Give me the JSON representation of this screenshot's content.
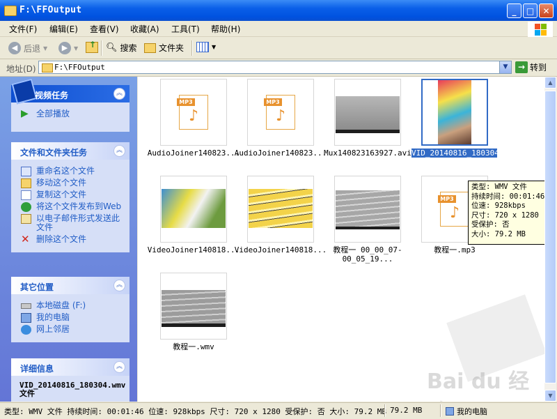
{
  "window": {
    "title": "F:\\FFOutput",
    "minimize": "_",
    "maximize": "□",
    "close": "✕"
  },
  "menu": [
    "文件(F)",
    "编辑(E)",
    "查看(V)",
    "收藏(A)",
    "工具(T)",
    "帮助(H)"
  ],
  "toolbar": {
    "back": "后退",
    "search": "搜索",
    "folders": "文件夹"
  },
  "address": {
    "label": "地址(D)",
    "path": "F:\\FFOutput",
    "go": "转到"
  },
  "left_panel": {
    "video_tasks": {
      "title": "视频任务",
      "items": [
        "全部播放"
      ]
    },
    "file_tasks": {
      "title": "文件和文件夹任务",
      "items": [
        "重命名这个文件",
        "移动这个文件",
        "复制这个文件",
        "将这个文件发布到Web",
        "以电子邮件形式发送此文件",
        "删除这个文件"
      ]
    },
    "other_places": {
      "title": "其它位置",
      "items": [
        "本地磁盘 (F:)",
        "我的电脑",
        "网上邻居"
      ]
    },
    "details": {
      "title": "详细信息",
      "name": "VID_20140816_180304.wmv 文件"
    }
  },
  "files": [
    {
      "name": "AudioJoiner140823...",
      "kind": "mp3"
    },
    {
      "name": "AudioJoiner140823...",
      "kind": "mp3"
    },
    {
      "name": "Mux140823163927.avi",
      "kind": "video-gray"
    },
    {
      "name": "VID_20140816_180304.wmv",
      "kind": "video-color",
      "selected": true
    },
    {
      "name": "VideoJoiner140818...",
      "kind": "video-people"
    },
    {
      "name": "VideoJoiner140818...",
      "kind": "video-yellow"
    },
    {
      "name": "教程一 00_00_07-00_05_19...",
      "kind": "video-gray"
    },
    {
      "name": "教程一.mp3",
      "kind": "mp3"
    },
    {
      "name": "教程一.wmv",
      "kind": "video-gray"
    }
  ],
  "tooltip": {
    "lines": [
      "类型: WMV 文件",
      "持续时间: 00:01:46",
      "位速: 928kbps",
      "尺寸: 720 x 1280",
      "受保护: 否",
      "大小: 79.2 MB"
    ]
  },
  "status": {
    "info": "类型: WMV 文件 持续时间: 00:01:46 位速: 928kbps 尺寸: 720 x 1280 受保护: 否 大小: 79.2 MB",
    "size": "79.2 MB",
    "location": "我的电脑"
  },
  "watermark": "Bai du 经验"
}
